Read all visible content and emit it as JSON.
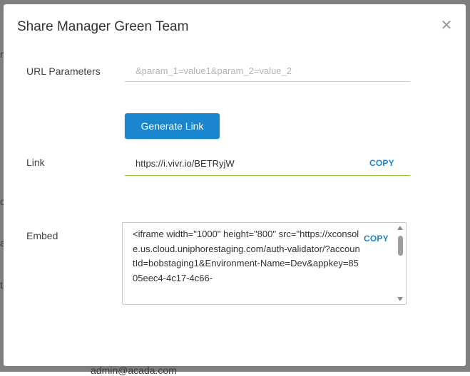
{
  "background": {
    "fragments": [
      "m",
      "d",
      "a",
      "t",
      "admin@acada.com"
    ]
  },
  "modal": {
    "title": "Share Manager Green Team",
    "close_icon": "close-icon",
    "url_params": {
      "label": "URL Parameters",
      "value": "",
      "placeholder": "&param_1=value1&param_2=value_2"
    },
    "generate_button": "Generate Link",
    "link": {
      "label": "Link",
      "value": "https://i.vivr.io/BETRyjW",
      "copy_label": "COPY"
    },
    "embed": {
      "label": "Embed",
      "code": "<iframe width=\"1000\" height=\"800\" src=\"https://xconsole.us.cloud.uniphorestaging.com/auth-validator/?accountId=bobstaging1&Environment-Name=Dev&appkey=8505eec4-4c17-4c66-",
      "copy_label": "COPY"
    }
  },
  "colors": {
    "primary": "#1a86d0",
    "valid_underline": "#8bc34a",
    "backdrop": "#7f7f7f"
  }
}
